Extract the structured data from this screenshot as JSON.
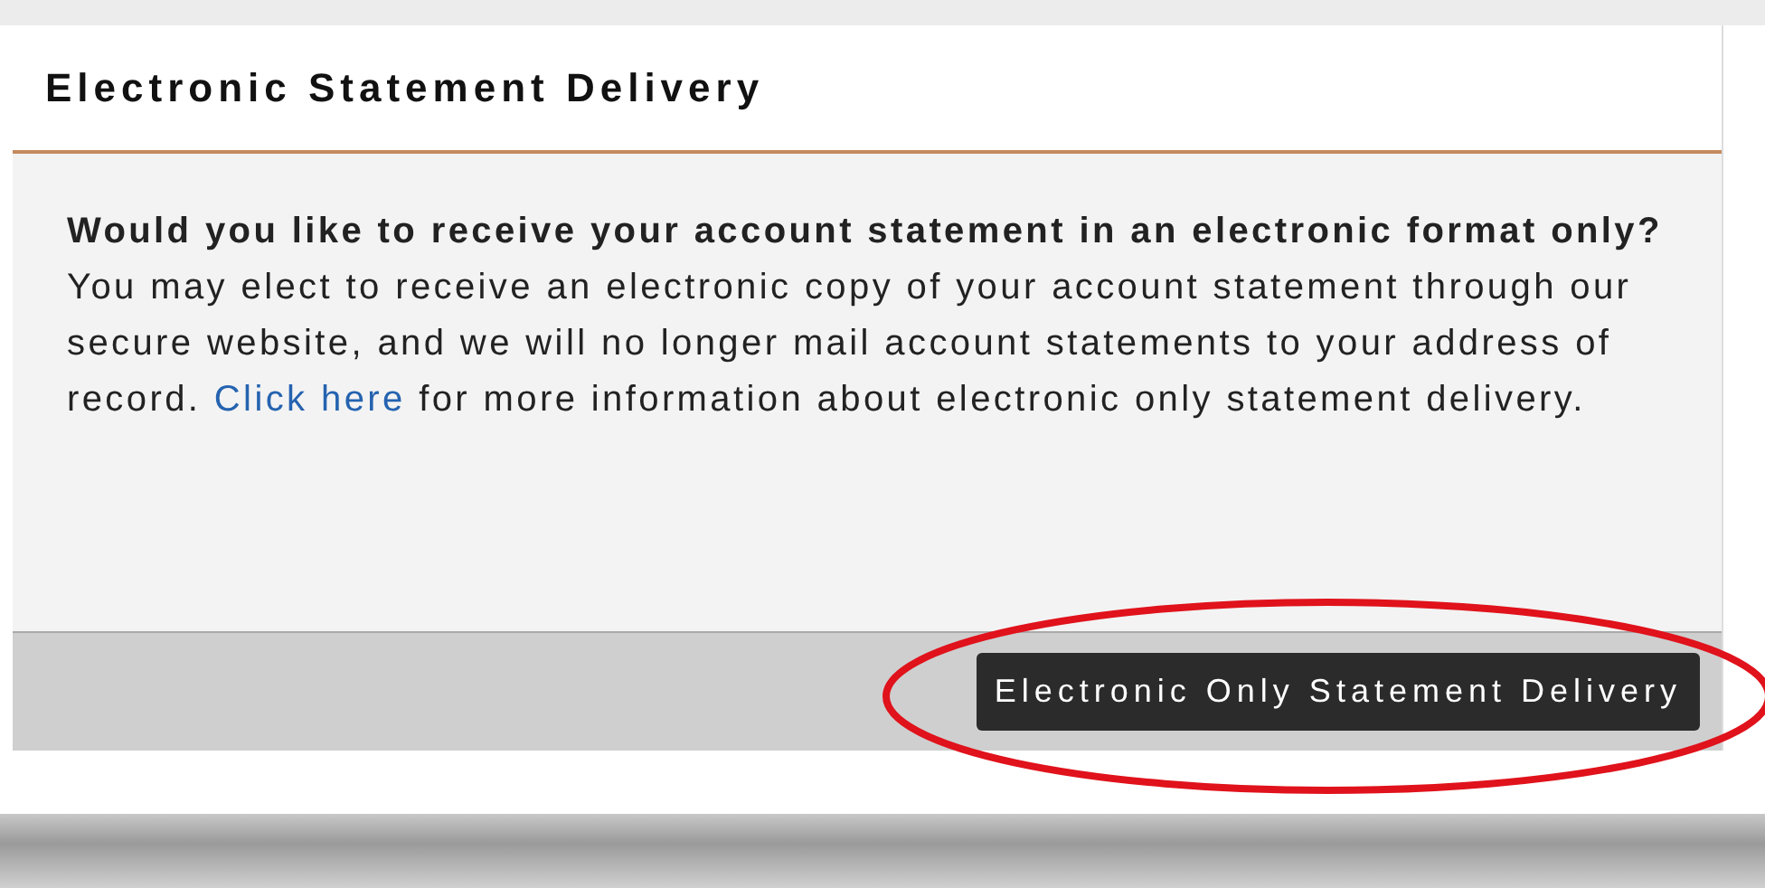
{
  "dialog": {
    "title": "Electronic Statement Delivery",
    "message": {
      "before": "**Would you like to receive your account statement in an electronic format only?** You may elect to receive an electronic copy of your account statement through our secure website, and we will no longer mail account statements to your address of record. ",
      "link": "Click here",
      "after": " for more information about electronic only statement delivery."
    },
    "button": "Electronic Only Statement Delivery"
  }
}
